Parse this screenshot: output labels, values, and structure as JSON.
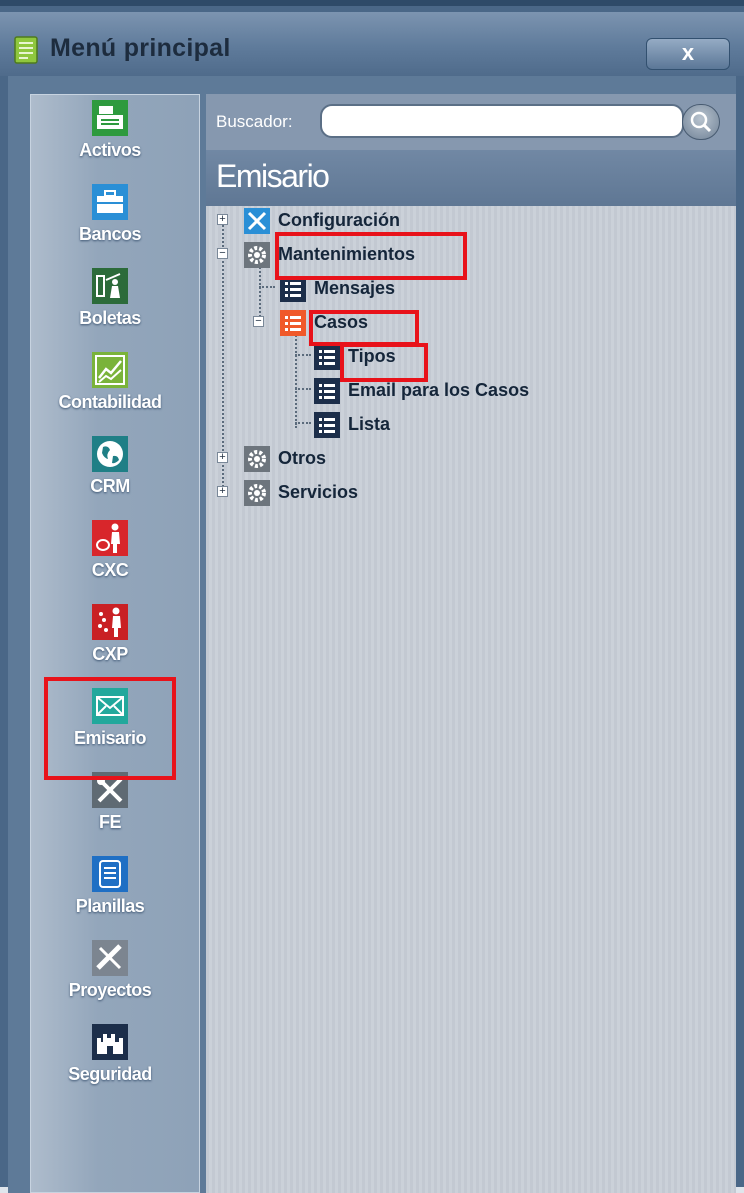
{
  "window": {
    "title": "Menú principal",
    "close_label": "x"
  },
  "sidebar": {
    "items": [
      {
        "label": "Activos",
        "icon": "cash-register-icon",
        "color": "#2e9a3e"
      },
      {
        "label": "Bancos",
        "icon": "briefcase-icon",
        "color": "#2a8fd6"
      },
      {
        "label": "Boletas",
        "icon": "presenter-icon",
        "color": "#2c6b3a"
      },
      {
        "label": "Contabilidad",
        "icon": "chart-icon",
        "color": "#7ab33a"
      },
      {
        "label": "CRM",
        "icon": "globe-icon",
        "color": "#1f7f86"
      },
      {
        "label": "CXC",
        "icon": "person-piggy-icon",
        "color": "#d8262b"
      },
      {
        "label": "CXP",
        "icon": "person-coins-icon",
        "color": "#c92024"
      },
      {
        "label": "Emisario",
        "icon": "envelope-icon",
        "color": "#22a89c"
      },
      {
        "label": "FE",
        "icon": "tools-icon",
        "color": "#5f6a73"
      },
      {
        "label": "Planillas",
        "icon": "document-icon",
        "color": "#1f6fc4"
      },
      {
        "label": "Proyectos",
        "icon": "ruler-pencil-icon",
        "color": "#7c8590"
      },
      {
        "label": "Seguridad",
        "icon": "castle-icon",
        "color": "#1c2e4a"
      }
    ]
  },
  "search": {
    "label": "Buscador:",
    "value": "",
    "placeholder": ""
  },
  "section": {
    "title": "Emisario"
  },
  "tree": {
    "configuracion": "Configuración",
    "mantenimientos": "Mantenimientos",
    "mensajes": "Mensajes",
    "casos": "Casos",
    "tipos": "Tipos",
    "email_casos": "Email para los Casos",
    "lista": "Lista",
    "otros": "Otros",
    "servicios": "Servicios"
  },
  "colors": {
    "highlight": "#e8121a",
    "accent": "#5f7794"
  }
}
